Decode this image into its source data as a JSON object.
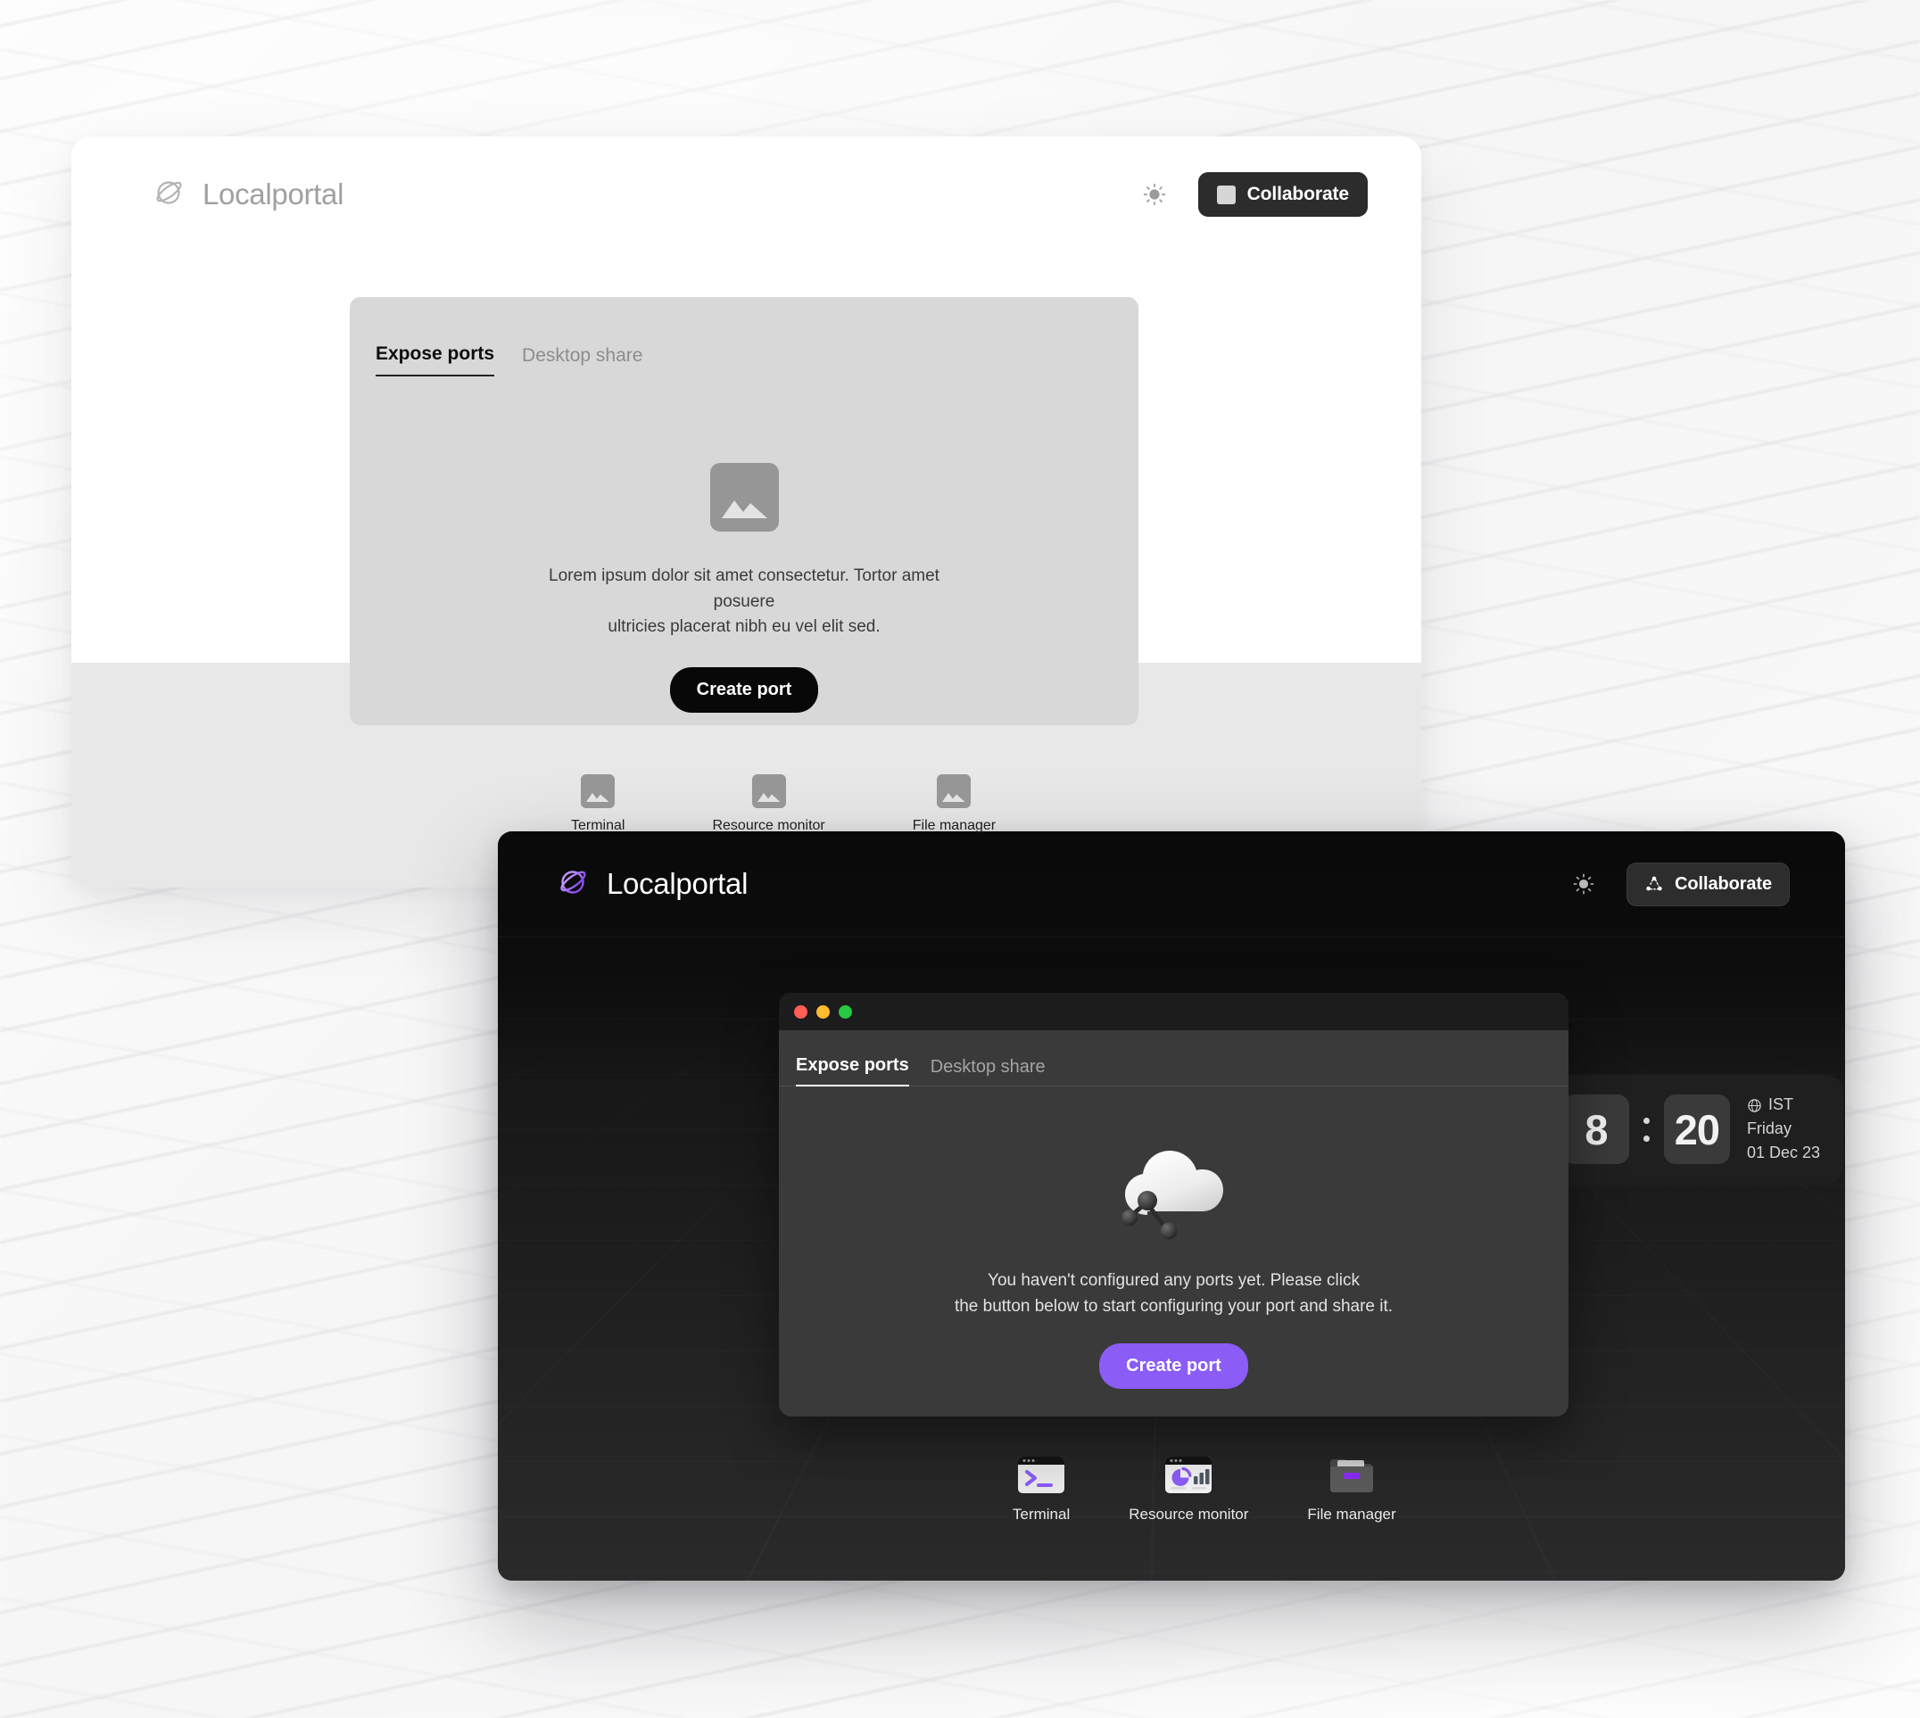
{
  "brand": {
    "name": "Localportal",
    "logo_icon": "planet-ring-icon"
  },
  "light_window": {
    "header": {
      "brightness_icon": "sun-icon",
      "collaborate_label": "Collaborate",
      "collaborate_icon": "placeholder-square-icon"
    },
    "card": {
      "tabs": [
        {
          "label": "Expose ports",
          "active": true
        },
        {
          "label": "Desktop share",
          "active": false
        }
      ],
      "placeholder_icon": "image-placeholder-icon",
      "description_line1": "Lorem ipsum dolor sit amet consectetur. Tortor amet posuere",
      "description_line2": "ultricies placerat nibh eu vel elit sed.",
      "create_button_label": "Create port"
    },
    "dock": [
      {
        "label": "Terminal",
        "icon": "image-placeholder-icon"
      },
      {
        "label": "Resource monitor",
        "icon": "image-placeholder-icon"
      },
      {
        "label": "File manager",
        "icon": "image-placeholder-icon"
      }
    ]
  },
  "dark_window": {
    "header": {
      "brightness_icon": "sun-icon",
      "collaborate_label": "Collaborate",
      "collaborate_icon": "share-nodes-icon"
    },
    "clock": {
      "hours": "8",
      "minutes": "20",
      "timezone": "IST",
      "timezone_icon": "globe-icon",
      "weekday": "Friday",
      "date": "01 Dec 23"
    },
    "modal": {
      "window_controls": [
        "close-red",
        "minimize-yellow",
        "maximize-green"
      ],
      "tabs": [
        {
          "label": "Expose ports",
          "active": true
        },
        {
          "label": "Desktop share",
          "active": false
        }
      ],
      "illustration": "cloud-share-icon",
      "description_line1": "You haven't configured any ports yet. Please click",
      "description_line2": "the button below to start configuring your port and share it.",
      "create_button_label": "Create port"
    },
    "dock": [
      {
        "label": "Terminal",
        "icon": "terminal-icon"
      },
      {
        "label": "Resource monitor",
        "icon": "chart-monitor-icon"
      },
      {
        "label": "File manager",
        "icon": "folder-icon"
      }
    ]
  },
  "colors": {
    "accent_purple": "#8b5cf6",
    "dark_surface": "#3a3a3a",
    "light_surface": "#d8d8d8",
    "black_button": "#080808"
  }
}
